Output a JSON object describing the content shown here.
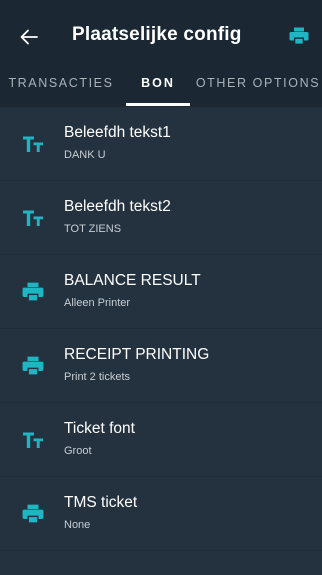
{
  "colors": {
    "accent": "#1fb5c3",
    "appbar_bg": "#1b2834",
    "list_bg": "#243240"
  },
  "appbar": {
    "back_icon": "arrow-left-icon",
    "title": "Plaatselijke config",
    "action_icon": "printer-icon"
  },
  "tabs": [
    {
      "label": "TRANSACTIES",
      "active": false
    },
    {
      "label": "BON",
      "active": true
    },
    {
      "label": "OTHER OPTIONS",
      "active": false
    }
  ],
  "settings": [
    {
      "icon": "text-size-icon",
      "label": "Beleefdh tekst1",
      "value": "DANK U"
    },
    {
      "icon": "text-size-icon",
      "label": "Beleefdh tekst2",
      "value": "TOT ZIENS"
    },
    {
      "icon": "printer-icon",
      "label": "BALANCE RESULT",
      "value": "Alleen Printer"
    },
    {
      "icon": "printer-icon",
      "label": "RECEIPT PRINTING",
      "value": "Print 2 tickets"
    },
    {
      "icon": "text-size-icon",
      "label": "Ticket font",
      "value": "Groot"
    },
    {
      "icon": "printer-icon",
      "label": "TMS ticket",
      "value": "None"
    }
  ]
}
